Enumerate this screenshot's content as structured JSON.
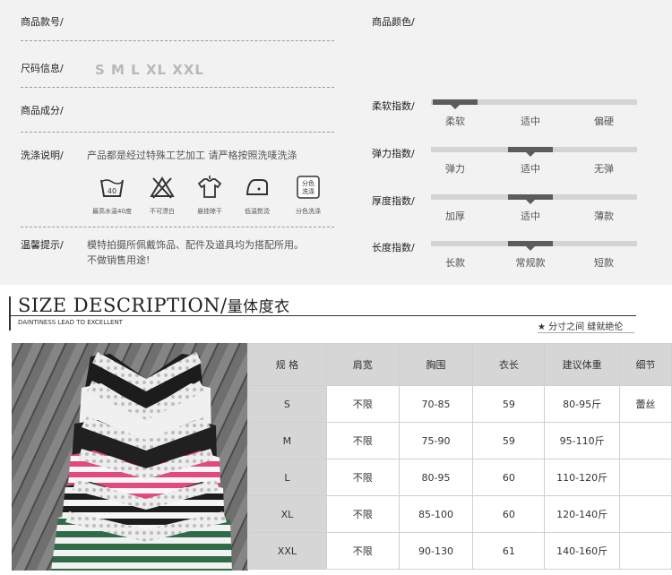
{
  "product": {
    "item_no_label": "商品款号/",
    "color_label": "商品颜色/",
    "size_info_label": "尺码信息/",
    "sizes": "S M L XL XXL",
    "material_label": "商品成分/",
    "wash_label": "洗涤说明/",
    "wash_text": "产品都是经过特殊工艺加工 请严格按照洗唛洗涤",
    "wash_icons": [
      {
        "icon": "wash-40-icon",
        "caption": "最高水温40度"
      },
      {
        "icon": "no-bleach-icon",
        "caption": "不可漂白"
      },
      {
        "icon": "hang-dry-icon",
        "caption": "悬挂晾干"
      },
      {
        "icon": "iron-low-icon",
        "caption": "低温熨烫"
      },
      {
        "icon": "separate-wash-icon",
        "caption": "分色洗涤",
        "badge": "分色\n洗涤"
      }
    ],
    "notice_label": "温馨提示/",
    "notice_line1": "模特拍摄所佩戴饰品、配件及道具均为搭配所用。",
    "notice_line2": "不做销售用途!"
  },
  "scales": [
    {
      "label": "柔软指数/",
      "options": [
        "柔软",
        "适中",
        "偏硬"
      ],
      "level": 0
    },
    {
      "label": "弹力指数/",
      "options": [
        "弹力",
        "适中",
        "无弹"
      ],
      "level": 1
    },
    {
      "label": "厚度指数/",
      "options": [
        "加厚",
        "适中",
        "薄款"
      ],
      "level": 1
    },
    {
      "label": "长度指数/",
      "options": [
        "长款",
        "常规款",
        "短款"
      ],
      "level": 1
    }
  ],
  "heading": {
    "title": "SIZE DESCRIPTION/",
    "title_cn": "量体度衣",
    "subtitle": "DAINTINESS LEAD TO EXCELLENT",
    "slogan": "★ 分寸之间 缝就绝伦"
  },
  "size_table": {
    "headers": [
      "规 格",
      "肩宽",
      "胸围",
      "衣长",
      "建议体重",
      "细节"
    ],
    "rows": [
      [
        "S",
        "不限",
        "70-85",
        "59",
        "80-95斤",
        "蕾丝"
      ],
      [
        "M",
        "不限",
        "75-90",
        "59",
        "95-110斤",
        ""
      ],
      [
        "L",
        "不限",
        "80-95",
        "60",
        "110-120斤",
        ""
      ],
      [
        "XL",
        "不限",
        "85-100",
        "60",
        "120-140斤",
        ""
      ],
      [
        "XXL",
        "不限",
        "90-130",
        "61",
        "140-160斤",
        ""
      ]
    ]
  },
  "colors": {
    "panel_bg": "#f2f2f2",
    "track": "#d4d4d4",
    "marker": "#5c5c5c",
    "table_header": "#d6d6d6"
  }
}
